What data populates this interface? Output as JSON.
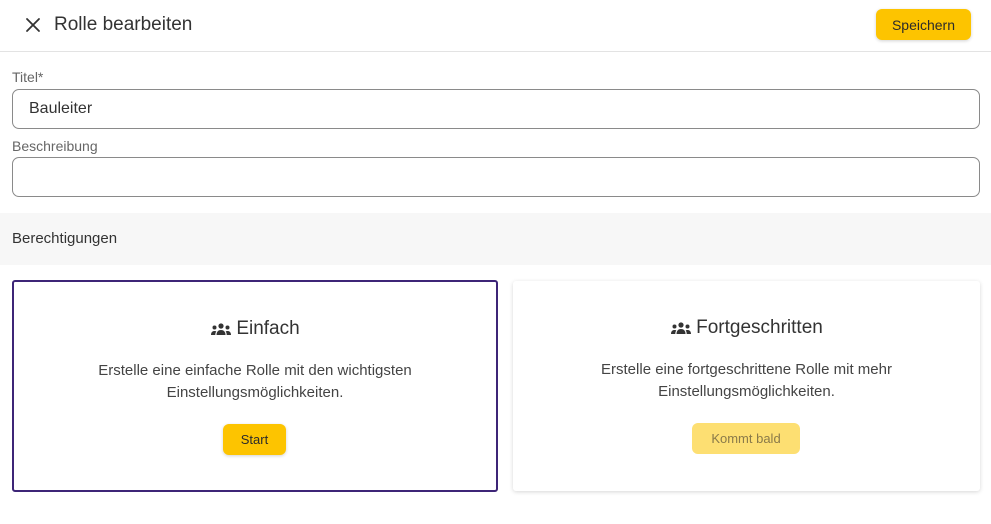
{
  "header": {
    "title": "Rolle bearbeiten",
    "save_label": "Speichern"
  },
  "form": {
    "title_label": "Titel*",
    "title_value": "Bauleiter",
    "description_label": "Beschreibung",
    "description_value": ""
  },
  "permissions": {
    "section_title": "Berechtigungen",
    "cards": [
      {
        "title": "Einfach",
        "icon": "group-icon",
        "description": "Erstelle eine einfache Rolle mit den wichtigsten Einstellungsmöglichkeiten.",
        "button_label": "Start",
        "selected": true
      },
      {
        "title": "Fortgeschritten",
        "icon": "group-icon",
        "description": "Erstelle eine fortgeschrittene Rolle mit mehr Einstellungsmöglichkeiten.",
        "button_label": "Kommt bald",
        "selected": false
      }
    ]
  },
  "colors": {
    "accent": "#fdc400",
    "accent_disabled": "#fddf72",
    "selected_border": "#3d2577",
    "section_background": "#f7f7f7"
  }
}
